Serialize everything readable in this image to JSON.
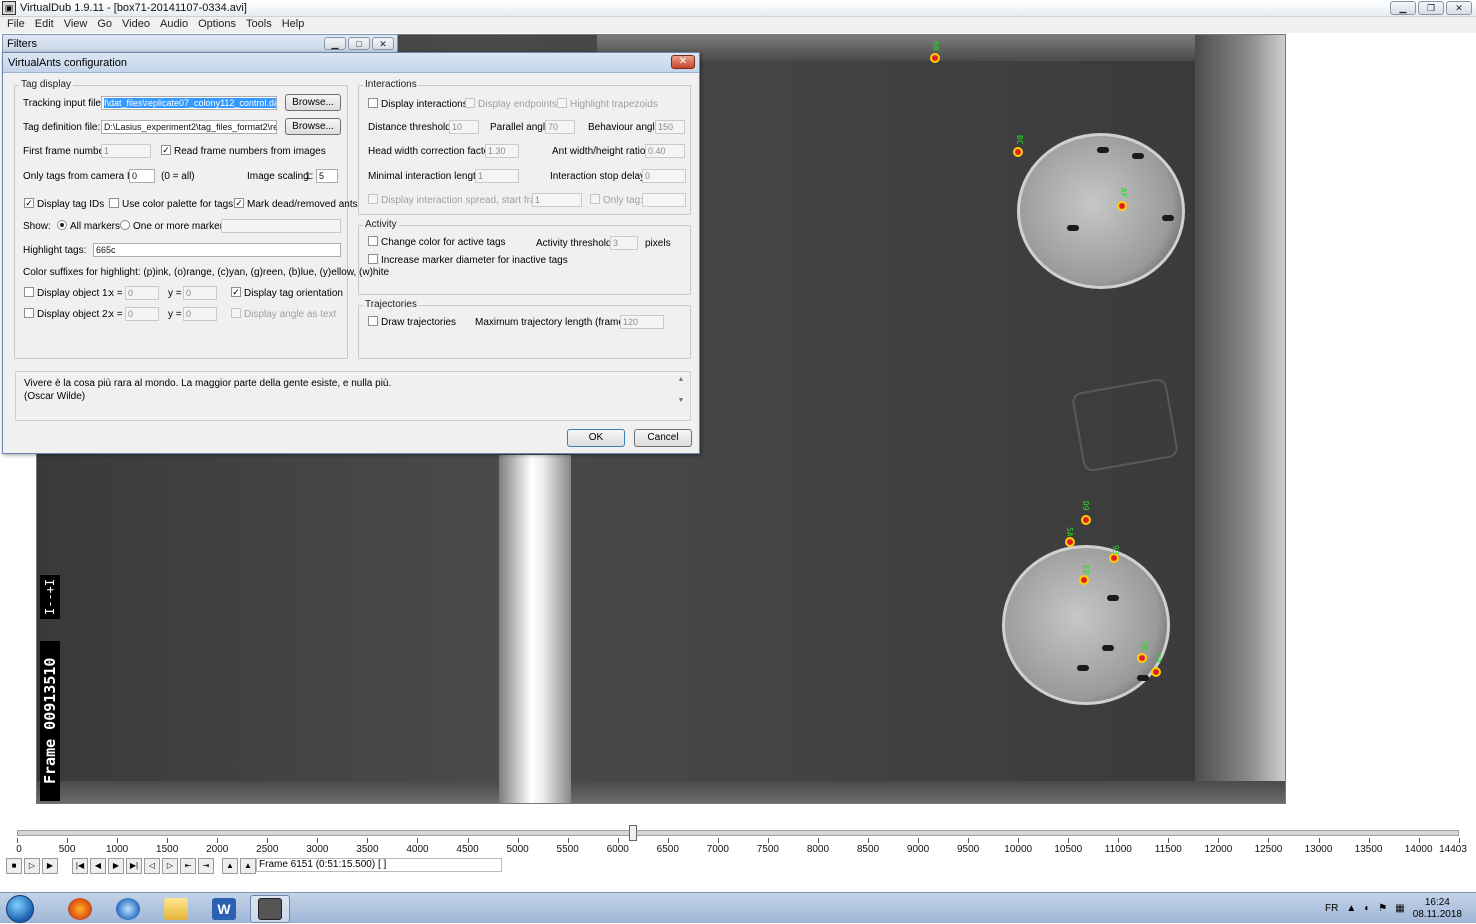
{
  "app": {
    "title": "VirtualDub 1.9.11 - [box71-20141107-0334.avi]",
    "menu": [
      "File",
      "Edit",
      "View",
      "Go",
      "Video",
      "Audio",
      "Options",
      "Tools",
      "Help"
    ]
  },
  "filters_window": {
    "title": "Filters"
  },
  "dialog": {
    "title": "VirtualAnts configuration",
    "close": "✕",
    "tag_display": {
      "group": "Tag display",
      "tracking_input_label": "Tracking input file:",
      "tracking_input_value": "I\\dat_files\\replicate07_colony112_control.dat",
      "tag_definition_label": "Tag definition file:",
      "tag_definition_value": "D:\\Lasius_experiment2\\tag_files_format2\\repli",
      "browse": "Browse...",
      "first_frame_label": "First frame number:",
      "first_frame_value": "1",
      "read_frame_numbers": "Read frame numbers from images",
      "only_tags_label": "Only tags from camera ID:",
      "only_tags_value": "0",
      "only_tags_hint": "(0 = all)",
      "image_scaling_label": "Image scaling:",
      "image_scaling_prefix": "1:",
      "image_scaling_value": "5",
      "display_tag_ids": "Display tag IDs",
      "use_color_palette": "Use color palette for tags",
      "mark_dead": "Mark dead/removed ants",
      "show_label": "Show:",
      "all_markers": "All markers",
      "one_or_more": "One or more markers:",
      "highlight_tags_label": "Highlight tags:",
      "highlight_tags_value": "665c",
      "color_suffixes": "Color suffixes for highlight: (p)ink, (o)range, (c)yan, (g)reen, (b)lue, (y)ellow, (w)hite",
      "display_object_1": "Display object 1:",
      "display_object_2": "Display object 2:",
      "x_label": "x =",
      "y_label": "y =",
      "obj_value": "0",
      "display_tag_orientation": "Display tag orientation",
      "display_angle_as_text": "Display angle as text"
    },
    "interactions": {
      "group": "Interactions",
      "display_interactions": "Display interactions",
      "display_endpoints": "Display endpoints",
      "highlight_trapezoids": "Highlight trapezoids",
      "distance_threshold_label": "Distance threshold:",
      "distance_threshold_value": "10",
      "parallel_angle_label": "Parallel angle:",
      "parallel_angle_value": "70",
      "behaviour_angle_label": "Behaviour angle:",
      "behaviour_angle_value": "150",
      "head_width_label": "Head width correction factor:",
      "head_width_value": "1.30",
      "ant_ratio_label": "Ant width/height ratio:",
      "ant_ratio_value": "0.40",
      "min_interaction_label": "Minimal interaction length:",
      "min_interaction_value": "1",
      "stop_delay_label": "Interaction stop delay:",
      "stop_delay_value": "0",
      "display_spread": "Display interaction spread, start frame:",
      "spread_value": "1",
      "only_tag": "Only tag:"
    },
    "activity": {
      "group": "Activity",
      "change_color": "Change color for active tags",
      "activity_threshold_label": "Activity threshold:",
      "activity_threshold_value": "3",
      "pixels": "pixels",
      "increase_marker": "Increase marker diameter for inactive tags"
    },
    "trajectories": {
      "group": "Trajectories",
      "draw": "Draw trajectories",
      "max_length_label": "Maximum trajectory length (frames):",
      "max_length_value": "120"
    },
    "quote": {
      "line1": "Vivere è la cosa più rara al mondo. La maggior parte della gente esiste, e nulla più.",
      "line2": "(Oscar Wilde)"
    },
    "ok": "OK",
    "cancel": "Cancel"
  },
  "video": {
    "frame_overlay": "Frame 00913510",
    "scale_overlay": "I--+I",
    "tags": [
      "60",
      "BC",
      "AF",
      "D9",
      "5A",
      "93",
      "EE",
      "7B",
      "C0"
    ]
  },
  "timeline": {
    "min": 0,
    "max": 14403,
    "position": 6151,
    "ticks": [
      "0",
      "500",
      "1000",
      "1500",
      "2000",
      "2500",
      "3000",
      "3500",
      "4000",
      "4500",
      "5000",
      "5500",
      "6000",
      "6500",
      "7000",
      "7500",
      "8000",
      "8500",
      "9000",
      "9500",
      "10000",
      "10500",
      "11000",
      "11500",
      "12000",
      "12500",
      "13000",
      "13500",
      "14000",
      "14403"
    ]
  },
  "status": {
    "frame": "Frame 6151 (0:51:15.500) [ ]"
  },
  "taskbar": {
    "apps": [
      "start-orb-icon",
      "firefox-icon",
      "thunderbird-icon",
      "file-explorer-icon",
      "word-icon",
      "virtualdub-icon"
    ],
    "lang": "FR",
    "time": "16:24",
    "date": "08.11.2018"
  }
}
